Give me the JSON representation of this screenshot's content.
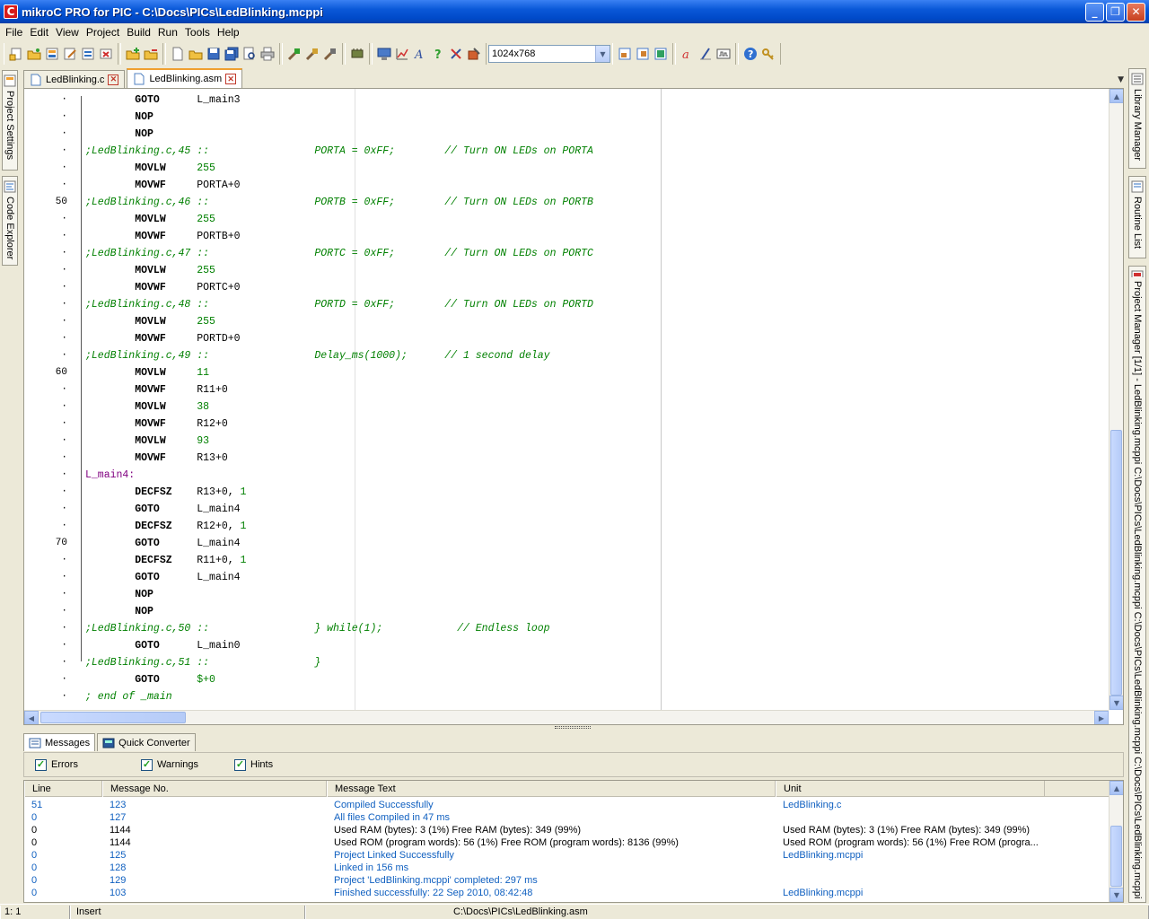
{
  "window": {
    "title": "mikroC PRO for PIC - C:\\Docs\\PICs\\LedBlinking.mcppi",
    "icon": "C",
    "minimize": "_",
    "maximize": "❐",
    "close": "✕"
  },
  "menu": [
    "File",
    "Edit",
    "View",
    "Project",
    "Build",
    "Run",
    "Tools",
    "Help"
  ],
  "toolbar": {
    "resolution_combo": "1024x768"
  },
  "left_dock": {
    "project_settings": "Project Settings",
    "code_explorer": "Code Explorer"
  },
  "right_dock": {
    "library_manager": "Library Manager",
    "routine_list": "Routine List",
    "project_manager": "Project Manager [1/1] - LedBlinking.mcppi  C:\\Docs\\PICs\\LedBlinking.mcppi  C:\\Docs\\PICs\\LedBlinking.mcppi  C:\\Docs\\PICs\\LedBlinking.mcppi"
  },
  "tabs": [
    {
      "label": "LedBlinking.c",
      "active": false
    },
    {
      "label": "LedBlinking.asm",
      "active": true
    }
  ],
  "gutter": [
    "·",
    "·",
    "·",
    "·",
    "·",
    "·",
    "50",
    "·",
    "·",
    "·",
    "·",
    "·",
    "·",
    "·",
    "·",
    "·",
    "60",
    "·",
    "·",
    "·",
    "·",
    "·",
    "·",
    "·",
    "·",
    "·",
    "70",
    "·",
    "·",
    "·",
    "·",
    "·",
    "·",
    "·",
    "·",
    "·"
  ],
  "code": [
    [
      {
        "c": "instr",
        "t": "        GOTO      "
      },
      {
        "c": "opnd",
        "t": "L_main3"
      }
    ],
    [
      {
        "c": "instr",
        "t": "        NOP"
      }
    ],
    [
      {
        "c": "instr",
        "t": "        NOP"
      }
    ],
    [
      {
        "c": "cmt",
        "t": ";LedBlinking.c,45 ::                 PORTA = 0xFF;        // Turn ON LEDs on PORTA"
      }
    ],
    [
      {
        "c": "instr",
        "t": "        MOVLW     "
      },
      {
        "c": "num",
        "t": "255"
      }
    ],
    [
      {
        "c": "instr",
        "t": "        MOVWF     "
      },
      {
        "c": "opnd",
        "t": "PORTA+0"
      }
    ],
    [
      {
        "c": "cmt",
        "t": ";LedBlinking.c,46 ::                 PORTB = 0xFF;        // Turn ON LEDs on PORTB"
      }
    ],
    [
      {
        "c": "instr",
        "t": "        MOVLW     "
      },
      {
        "c": "num",
        "t": "255"
      }
    ],
    [
      {
        "c": "instr",
        "t": "        MOVWF     "
      },
      {
        "c": "opnd",
        "t": "PORTB+0"
      }
    ],
    [
      {
        "c": "cmt",
        "t": ";LedBlinking.c,47 ::                 PORTC = 0xFF;        // Turn ON LEDs on PORTC"
      }
    ],
    [
      {
        "c": "instr",
        "t": "        MOVLW     "
      },
      {
        "c": "num",
        "t": "255"
      }
    ],
    [
      {
        "c": "instr",
        "t": "        MOVWF     "
      },
      {
        "c": "opnd",
        "t": "PORTC+0"
      }
    ],
    [
      {
        "c": "cmt",
        "t": ";LedBlinking.c,48 ::                 PORTD = 0xFF;        // Turn ON LEDs on PORTD"
      }
    ],
    [
      {
        "c": "instr",
        "t": "        MOVLW     "
      },
      {
        "c": "num",
        "t": "255"
      }
    ],
    [
      {
        "c": "instr",
        "t": "        MOVWF     "
      },
      {
        "c": "opnd",
        "t": "PORTD+0"
      }
    ],
    [
      {
        "c": "cmt",
        "t": ";LedBlinking.c,49 ::                 Delay_ms(1000);      // 1 second delay"
      }
    ],
    [
      {
        "c": "instr",
        "t": "        MOVLW     "
      },
      {
        "c": "num",
        "t": "11"
      }
    ],
    [
      {
        "c": "instr",
        "t": "        MOVWF     "
      },
      {
        "c": "opnd",
        "t": "R11+0"
      }
    ],
    [
      {
        "c": "instr",
        "t": "        MOVLW     "
      },
      {
        "c": "num",
        "t": "38"
      }
    ],
    [
      {
        "c": "instr",
        "t": "        MOVWF     "
      },
      {
        "c": "opnd",
        "t": "R12+0"
      }
    ],
    [
      {
        "c": "instr",
        "t": "        MOVLW     "
      },
      {
        "c": "num",
        "t": "93"
      }
    ],
    [
      {
        "c": "instr",
        "t": "        MOVWF     "
      },
      {
        "c": "opnd",
        "t": "R13+0"
      }
    ],
    [
      {
        "c": "lbl",
        "t": "L_main4:"
      }
    ],
    [
      {
        "c": "instr",
        "t": "        DECFSZ    "
      },
      {
        "c": "opnd",
        "t": "R13+0, "
      },
      {
        "c": "num",
        "t": "1"
      }
    ],
    [
      {
        "c": "instr",
        "t": "        GOTO      "
      },
      {
        "c": "opnd",
        "t": "L_main4"
      }
    ],
    [
      {
        "c": "instr",
        "t": "        DECFSZ    "
      },
      {
        "c": "opnd",
        "t": "R12+0, "
      },
      {
        "c": "num",
        "t": "1"
      }
    ],
    [
      {
        "c": "instr",
        "t": "        GOTO      "
      },
      {
        "c": "opnd",
        "t": "L_main4"
      }
    ],
    [
      {
        "c": "instr",
        "t": "        DECFSZ    "
      },
      {
        "c": "opnd",
        "t": "R11+0, "
      },
      {
        "c": "num",
        "t": "1"
      }
    ],
    [
      {
        "c": "instr",
        "t": "        GOTO      "
      },
      {
        "c": "opnd",
        "t": "L_main4"
      }
    ],
    [
      {
        "c": "instr",
        "t": "        NOP"
      }
    ],
    [
      {
        "c": "instr",
        "t": "        NOP"
      }
    ],
    [
      {
        "c": "cmt",
        "t": ";LedBlinking.c,50 ::                 } while(1);            // Endless loop"
      }
    ],
    [
      {
        "c": "instr",
        "t": "        GOTO      "
      },
      {
        "c": "opnd",
        "t": "L_main0"
      }
    ],
    [
      {
        "c": "cmt",
        "t": ";LedBlinking.c,51 ::                 }"
      }
    ],
    [
      {
        "c": "instr",
        "t": "        GOTO      "
      },
      {
        "c": "num",
        "t": "$+0"
      }
    ],
    [
      {
        "c": "cmt",
        "t": "; end of _main"
      }
    ]
  ],
  "messages": {
    "tabs": [
      "Messages",
      "Quick Converter"
    ],
    "filters": [
      {
        "label": "Errors",
        "checked": true
      },
      {
        "label": "Warnings",
        "checked": true
      },
      {
        "label": "Hints",
        "checked": true
      }
    ],
    "columns": [
      "Line",
      "Message No.",
      "Message Text",
      "Unit"
    ],
    "rows": [
      {
        "line": "51",
        "no": "123",
        "text": "Compiled Successfully",
        "unit": "LedBlinking.c",
        "hint": true
      },
      {
        "line": "0",
        "no": "127",
        "text": "All files Compiled in 47 ms",
        "unit": "",
        "hint": true
      },
      {
        "line": "0",
        "no": "1144",
        "text": "Used RAM (bytes): 3 (1%)  Free RAM (bytes): 349 (99%)",
        "unit": "Used RAM (bytes): 3 (1%)  Free RAM (bytes): 349 (99%)",
        "hint": false
      },
      {
        "line": "0",
        "no": "1144",
        "text": "Used ROM (program words): 56 (1%)  Free ROM (program words): 8136 (99%)",
        "unit": "Used ROM (program words): 56 (1%)  Free ROM (progra...",
        "hint": false
      },
      {
        "line": "0",
        "no": "125",
        "text": "Project Linked Successfully",
        "unit": "LedBlinking.mcppi",
        "hint": true
      },
      {
        "line": "0",
        "no": "128",
        "text": "Linked in 156 ms",
        "unit": "",
        "hint": true
      },
      {
        "line": "0",
        "no": "129",
        "text": "Project 'LedBlinking.mcppi' completed: 297 ms",
        "unit": "",
        "hint": true
      },
      {
        "line": "0",
        "no": "103",
        "text": "Finished successfully: 22 Sep 2010, 08:42:48",
        "unit": "LedBlinking.mcppi",
        "hint": true
      }
    ]
  },
  "status": {
    "position": "1: 1",
    "mode": "Insert",
    "file": "C:\\Docs\\PICs\\LedBlinking.asm"
  },
  "colors": {
    "title_bar": "#0a58d8",
    "hint_text": "#1060c0",
    "comment": "#008000",
    "label": "#800080"
  }
}
